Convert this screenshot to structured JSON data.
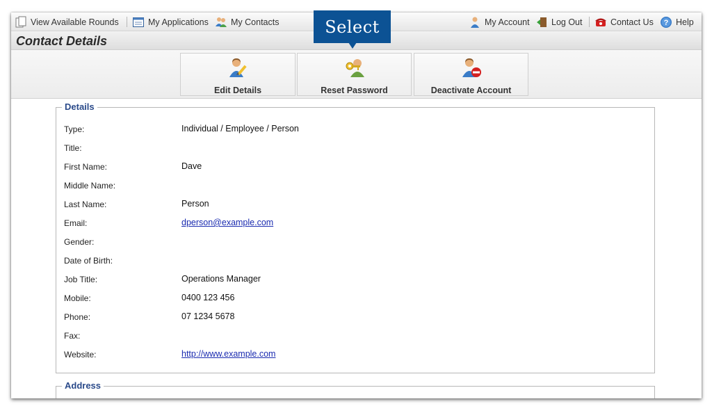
{
  "nav": {
    "view_rounds": "View Available Rounds",
    "my_applications": "My Applications",
    "my_contacts": "My Contacts",
    "my_account": "My Account",
    "log_out": "Log Out",
    "contact_us": "Contact Us",
    "help": "Help"
  },
  "page": {
    "title": "Contact Details"
  },
  "toolbar": {
    "edit_details": "Edit Details",
    "reset_password": "Reset Password",
    "deactivate_account": "Deactivate Account"
  },
  "callout": {
    "text": "Select"
  },
  "details": {
    "legend": "Details",
    "rows": [
      {
        "label": "Type:",
        "value": "Individual / Employee / Person"
      },
      {
        "label": "Title:",
        "value": ""
      },
      {
        "label": "First Name:",
        "value": "Dave"
      },
      {
        "label": "Middle Name:",
        "value": ""
      },
      {
        "label": "Last Name:",
        "value": "Person"
      },
      {
        "label": "Email:",
        "value": "dperson@example.com"
      },
      {
        "label": "Gender:",
        "value": ""
      },
      {
        "label": "Date of Birth:",
        "value": ""
      },
      {
        "label": "Job Title:",
        "value": "Operations Manager"
      },
      {
        "label": "Mobile:",
        "value": "0400 123 456"
      },
      {
        "label": "Phone:",
        "value": "07 1234 5678"
      },
      {
        "label": "Fax:",
        "value": ""
      },
      {
        "label": "Website:",
        "value": "http://www.example.com"
      }
    ]
  },
  "address": {
    "legend": "Address"
  },
  "colors": {
    "accent": "#0c5294",
    "link": "#1a2bb0",
    "legend": "#2a4a8a"
  }
}
